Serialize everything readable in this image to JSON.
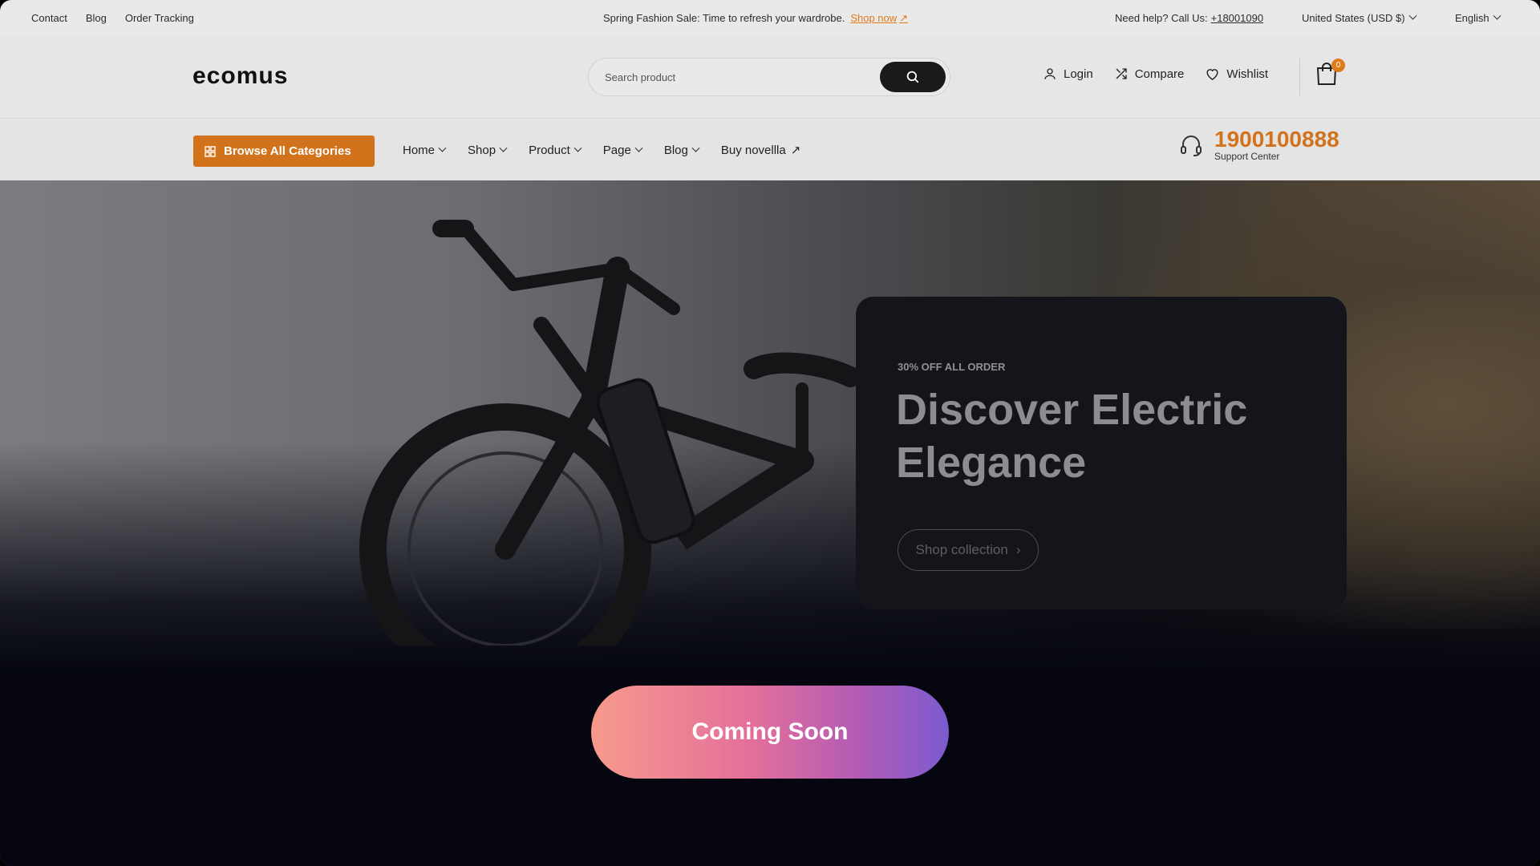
{
  "topbar": {
    "links": [
      "Contact",
      "Blog",
      "Order Tracking"
    ],
    "promo_text": "Spring Fashion Sale: Time to refresh your wardrobe.",
    "promo_link": "Shop now",
    "help_text": "Need help? Call Us:",
    "help_phone": "+18001090",
    "currency": "United States (USD $)",
    "language": "English"
  },
  "header": {
    "logo": "ecomus",
    "search_placeholder": "Search product",
    "login": "Login",
    "compare": "Compare",
    "wishlist": "Wishlist",
    "cart_count": "0"
  },
  "nav": {
    "browse_label": "Browse All Categories",
    "items": [
      "Home",
      "Shop",
      "Product",
      "Page",
      "Blog"
    ],
    "external_item": "Buy novellla",
    "support_number": "1900100888",
    "support_label": "Support Center"
  },
  "hero": {
    "tag": "30% OFF ALL ORDER",
    "title": "Discover Electric Elegance",
    "cta": "Shop collection"
  },
  "overlay": {
    "label": "Coming Soon"
  },
  "colors": {
    "accent": "#d2731c",
    "dark": "#05060f"
  }
}
